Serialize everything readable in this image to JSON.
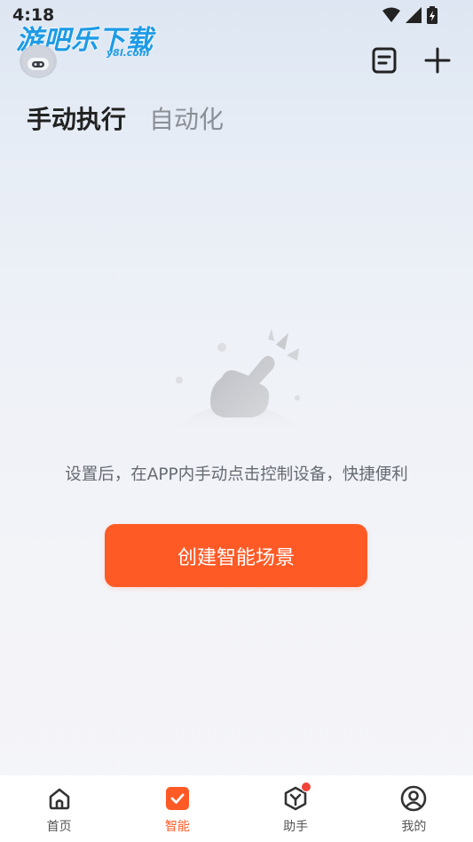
{
  "status_bar": {
    "time": "4:18"
  },
  "watermark": {
    "title": "游吧乐下载",
    "subtitle": "y8l.com"
  },
  "header": {
    "avatar_icon": "robot-avatar-icon",
    "actions": [
      {
        "icon": "document-icon"
      },
      {
        "icon": "plus-icon"
      }
    ]
  },
  "tabs": [
    {
      "label": "手动执行",
      "active": true
    },
    {
      "label": "自动化",
      "active": false
    }
  ],
  "empty_state": {
    "illustration_icon": "tap-hand-icon",
    "message": "设置后，在APP内手动点击控制设备，快捷便利",
    "button_label": "创建智能场景"
  },
  "bottom_nav": {
    "items": [
      {
        "label": "首页",
        "icon": "home-icon",
        "active": false
      },
      {
        "label": "智能",
        "icon": "smart-check-icon",
        "active": true
      },
      {
        "label": "助手",
        "icon": "assistant-icon",
        "active": false,
        "badge": true
      },
      {
        "label": "我的",
        "icon": "profile-icon",
        "active": false
      }
    ]
  },
  "colors": {
    "accent": "#fe5a26",
    "badge": "#f0433a",
    "text_primary": "#222222",
    "text_secondary": "#666a72"
  }
}
